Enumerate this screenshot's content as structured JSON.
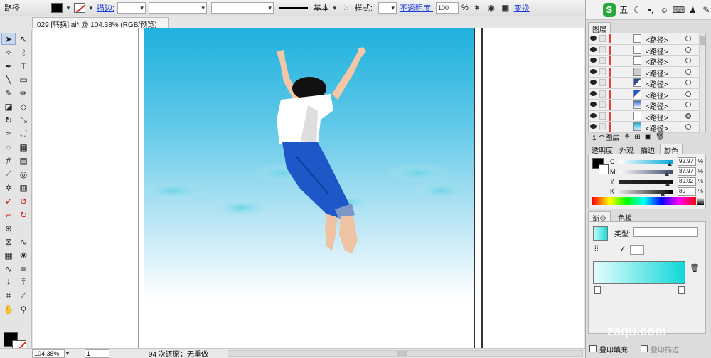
{
  "control_bar": {
    "object_type": "路径",
    "stroke_label": "描边:",
    "stroke_style_label": "基本",
    "style_label": "样式:",
    "opacity_label": "不透明度:",
    "opacity_value": "100",
    "opacity_unit": "%",
    "transform_label": "变换"
  },
  "document": {
    "tab_title": "029 [转换].ai* @ 104.38% (RGB/预览)",
    "close": "✕"
  },
  "status_bar": {
    "zoom": "104.38%",
    "page": "1",
    "info": "94 次还原；无重做"
  },
  "ime_bar": {
    "logo": "S",
    "mode": "五"
  },
  "layers_panel": {
    "tab_label": "图层",
    "rows": [
      {
        "name": "<路径>",
        "thumb": "blank",
        "target": "empty"
      },
      {
        "name": "<路径>",
        "thumb": "blank",
        "target": "empty"
      },
      {
        "name": "<路径>",
        "thumb": "blank",
        "target": "empty"
      },
      {
        "name": "<路径>",
        "thumb": "gray",
        "target": "empty"
      },
      {
        "name": "<路径>",
        "thumb": "hair",
        "target": "empty"
      },
      {
        "name": "<路径>",
        "thumb": "pants",
        "target": "empty"
      },
      {
        "name": "<路径>",
        "thumb": "shirt",
        "target": "empty"
      },
      {
        "name": "<路径>",
        "thumb": "blank",
        "target": "filled"
      },
      {
        "name": "<路径>",
        "thumb": "sky",
        "target": "empty"
      }
    ],
    "footer": "1 个图层"
  },
  "panel_tabs_top": [
    "透明度",
    "外观",
    "描边",
    "颜色"
  ],
  "color_panel": {
    "channels": [
      {
        "name": "C",
        "value": "92.97",
        "level": 0.9297,
        "slider": [
          "#ffffff",
          "#00a6d8"
        ]
      },
      {
        "name": "M",
        "value": "87.97",
        "level": 0.8797,
        "slider": [
          "#ffffff",
          "#404a6a"
        ]
      },
      {
        "name": "Y",
        "value": "89.02",
        "level": 0.8902,
        "slider": [
          "#2a2a2a",
          "#101010"
        ]
      },
      {
        "name": "K",
        "value": "80",
        "level": 0.8,
        "slider": [
          "#e8e8e8",
          "#000000"
        ]
      }
    ],
    "unit": "%"
  },
  "panel_tabs_mid": [
    "渐变",
    "色板"
  ],
  "gradient_panel": {
    "type_label": "类型:"
  },
  "bottom_options": {
    "overprint_fill": "叠印填充",
    "overprint_stroke": "叠印描边"
  },
  "watermark": "zaqu.com",
  "colors": {
    "sky_top": "#1fb1dd",
    "sky_bottom": "#ffffff",
    "layer_bar": "#e04040",
    "link": "#1a3fd6"
  }
}
